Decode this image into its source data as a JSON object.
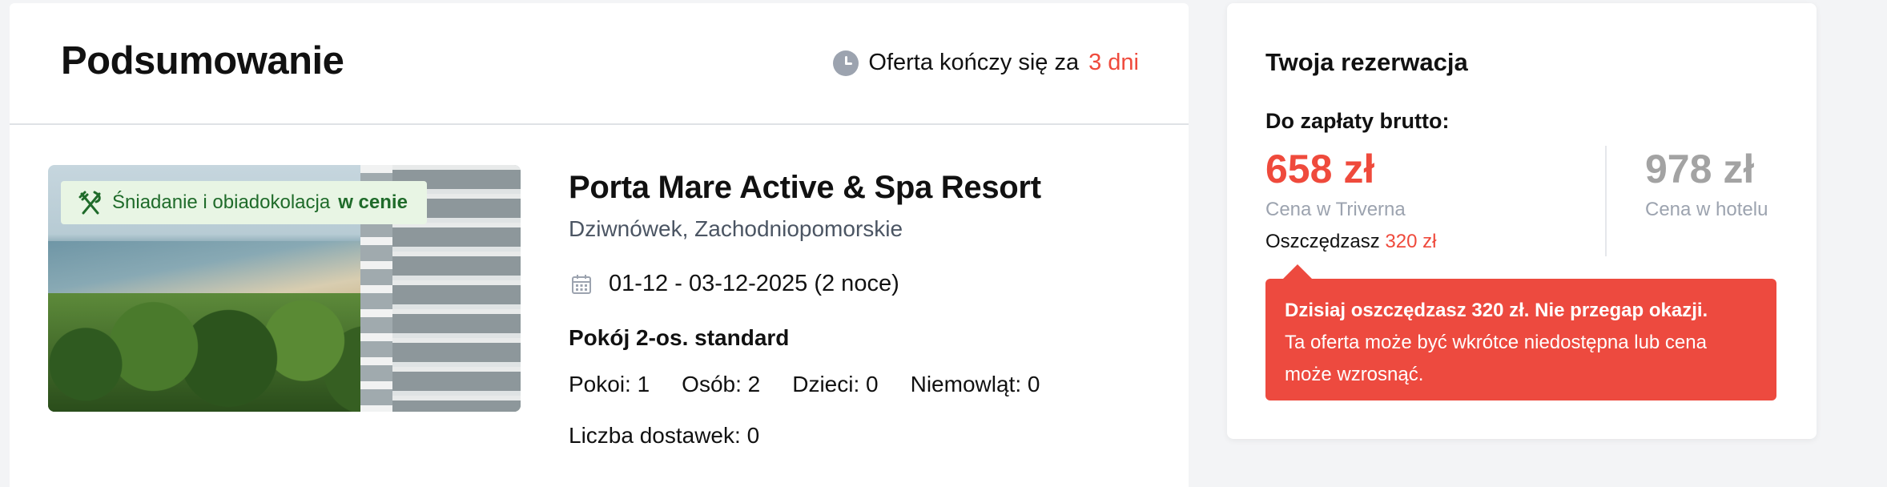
{
  "summary": {
    "title": "Podsumowanie",
    "offer_timer_prefix": "Oferta kończy się za",
    "offer_timer_days": "3 dni"
  },
  "hotel": {
    "meal_badge_text": "Śniadanie i obiadokolacja",
    "meal_badge_strong": "w cenie",
    "name": "Porta Mare Active & Spa Resort",
    "location": "Dziwnówek, Zachodniopomorskie",
    "dates": "01-12 - 03-12-2025 (2 noce)",
    "room_type": "Pokój 2-os. standard",
    "occupancy": [
      "Pokoi: 1",
      "Osób: 2",
      "Dzieci: 0",
      "Niemowląt: 0"
    ],
    "extra_beds": "Liczba dostawek: 0"
  },
  "booking": {
    "title": "Twoja rezerwacja",
    "pay_label": "Do zapłaty brutto:",
    "price": "658 zł",
    "price_label": "Cena w Triverna",
    "savings_prefix": "Oszczędzasz",
    "savings_value": "320 zł",
    "hotel_price": "978 zł",
    "hotel_price_label": "Cena w hotelu",
    "alert_strong": "Dzisiaj oszczędzasz 320 zł. Nie przegap okazji.",
    "alert_text": "Ta oferta może być wkrótce niedostępna lub cena może wzrosnąć."
  },
  "colors": {
    "accent": "#ef4a3c",
    "badge_bg": "#e8f5e4",
    "badge_text": "#1f6b2a"
  }
}
